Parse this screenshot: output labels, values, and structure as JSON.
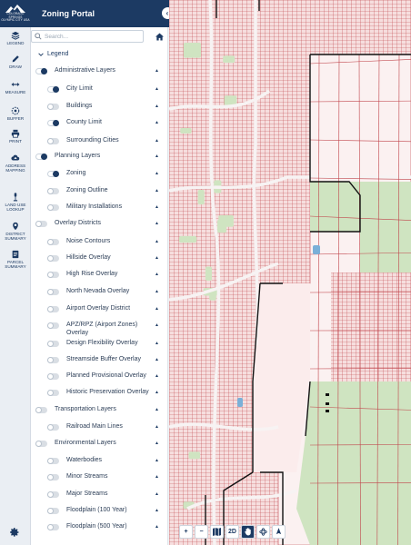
{
  "header": {
    "logo_lines": [
      "COLORADO",
      "SPRINGS",
      "OLYMPIC CITY USA"
    ],
    "title": "Zoning Portal"
  },
  "rail": {
    "tools": [
      {
        "icon": "layers-icon",
        "label": "LEGEND"
      },
      {
        "icon": "pencil-icon",
        "label": "DRAW"
      },
      {
        "icon": "measure-icon",
        "label": "MEASURE"
      },
      {
        "icon": "buffer-icon",
        "label": "BUFFER"
      },
      {
        "icon": "print-icon",
        "label": "PRINT"
      },
      {
        "icon": "cloud-icon",
        "label": "ADDRESS MAPPING"
      },
      {
        "icon": "land-use-icon",
        "label": "LAND USE LOOKUP"
      },
      {
        "icon": "district-icon",
        "label": "DISTRICT SUMMARY"
      },
      {
        "icon": "parcel-icon",
        "label": "PARCEL SUMMARY"
      }
    ],
    "settings_icon": "gear-icon"
  },
  "search": {
    "placeholder": "Search..."
  },
  "legend": {
    "label": "Legend",
    "layers": [
      {
        "label": "Administrative Layers",
        "control": "radio",
        "on": true,
        "indent": 0
      },
      {
        "label": "City Limit",
        "control": "radio",
        "on": true,
        "indent": 1
      },
      {
        "label": "Buildings",
        "control": "toggle",
        "on": false,
        "indent": 1
      },
      {
        "label": "County Limit",
        "control": "radio",
        "on": true,
        "indent": 1
      },
      {
        "label": "Surrounding Cities",
        "control": "toggle",
        "on": false,
        "indent": 1
      },
      {
        "label": "Planning Layers",
        "control": "radio",
        "on": true,
        "indent": 0
      },
      {
        "label": "Zoning",
        "control": "radio",
        "on": true,
        "indent": 1
      },
      {
        "label": "Zoning Outline",
        "control": "toggle",
        "on": false,
        "indent": 1
      },
      {
        "label": "Military Installations",
        "control": "toggle",
        "on": false,
        "indent": 1
      },
      {
        "label": "Overlay Districts",
        "control": "toggle",
        "on": false,
        "indent": 0
      },
      {
        "label": "Noise Contours",
        "control": "toggle",
        "on": false,
        "indent": 1
      },
      {
        "label": "Hillside Overlay",
        "control": "toggle",
        "on": false,
        "indent": 1
      },
      {
        "label": "High Rise Overlay",
        "control": "toggle",
        "on": false,
        "indent": 1
      },
      {
        "label": "North Nevada Overlay",
        "control": "toggle",
        "on": false,
        "indent": 1
      },
      {
        "label": "Airport Overlay District",
        "control": "toggle",
        "on": false,
        "indent": 1
      },
      {
        "label": "APZ/RPZ (Airport Zones) Overlay",
        "control": "toggle",
        "on": false,
        "indent": 1
      },
      {
        "label": "Design Flexibility Overlay",
        "control": "toggle",
        "on": false,
        "indent": 1
      },
      {
        "label": "Streamside Buffer Overlay",
        "control": "toggle",
        "on": false,
        "indent": 1
      },
      {
        "label": "Planned Provisional Overlay",
        "control": "toggle",
        "on": false,
        "indent": 1
      },
      {
        "label": "Historic Preservation Overlay",
        "control": "toggle",
        "on": false,
        "indent": 1
      },
      {
        "label": "Transportation Layers",
        "control": "toggle",
        "on": false,
        "indent": 0
      },
      {
        "label": "Railroad Main Lines",
        "control": "toggle",
        "on": false,
        "indent": 1
      },
      {
        "label": "Environmental Layers",
        "control": "toggle",
        "on": false,
        "indent": 0
      },
      {
        "label": "Waterbodies",
        "control": "toggle",
        "on": false,
        "indent": 1
      },
      {
        "label": "Minor Streams",
        "control": "toggle",
        "on": false,
        "indent": 1
      },
      {
        "label": "Major Streams",
        "control": "toggle",
        "on": false,
        "indent": 1
      },
      {
        "label": "Floodplain (100 Year)",
        "control": "toggle",
        "on": false,
        "indent": 1
      },
      {
        "label": "Floodplain (500 Year)",
        "control": "toggle",
        "on": false,
        "indent": 1
      }
    ]
  },
  "map_tools": {
    "zoom_in": "+",
    "zoom_out": "−",
    "view_2d": "2D"
  },
  "colors": {
    "brand": "#1c3a63",
    "parcel_red": "#c0444b",
    "open_space_green": "#cfe4c1",
    "boundary": "#111111"
  }
}
